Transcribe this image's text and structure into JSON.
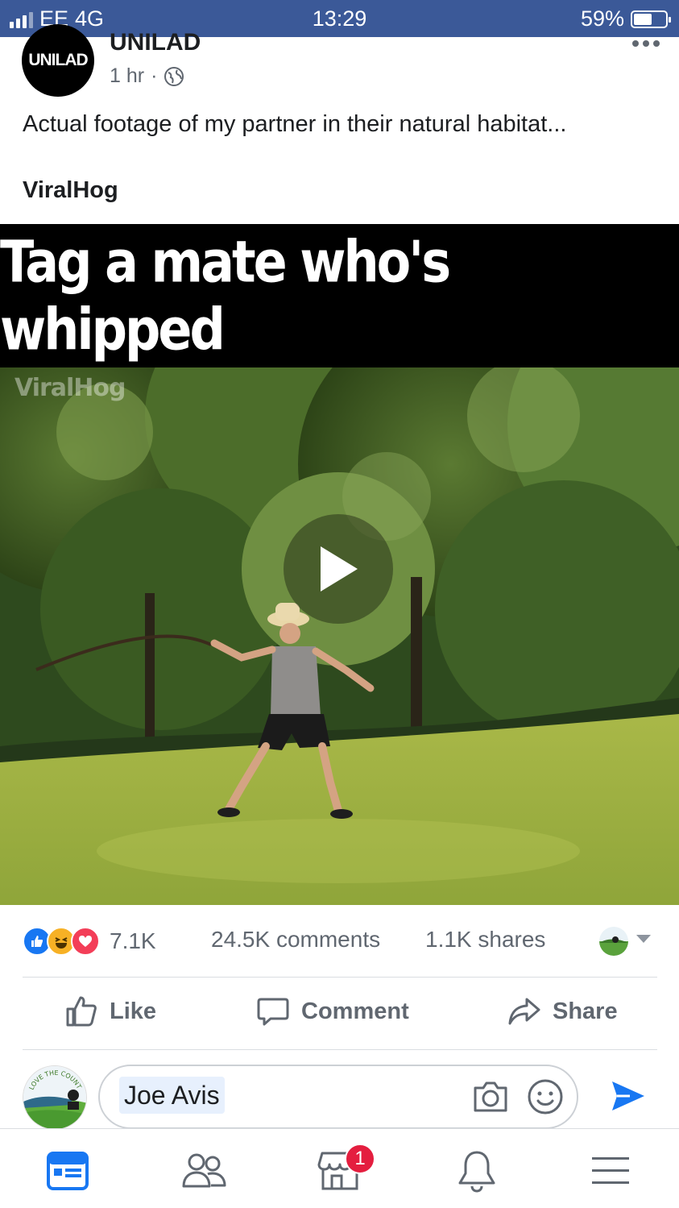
{
  "status_bar": {
    "carrier": "EE",
    "network": "4G",
    "time": "13:29",
    "battery_percent": "59%",
    "battery_level": 0.59
  },
  "post": {
    "page_name": "UNILAD",
    "avatar_text": "UNILAD",
    "time_ago": "1 hr",
    "privacy_icon": "globe-icon",
    "text": "Actual footage of my partner in their natural habitat...",
    "source": "ViralHog",
    "video": {
      "caption": "Tag a mate who's whipped",
      "watermark": "ViralHog"
    }
  },
  "engagement": {
    "reaction_icons": [
      "like-icon",
      "haha-icon",
      "love-icon"
    ],
    "reaction_count": "7.1K",
    "comments": "24.5K comments",
    "shares": "1.1K shares"
  },
  "actions": {
    "like": "Like",
    "comment": "Comment",
    "share": "Share"
  },
  "composer": {
    "mention": "Joe Avis",
    "avatar_text": "LOVE THE COUNTRYSIDE"
  },
  "bottom_nav": {
    "items": [
      "news-feed-icon",
      "friends-icon",
      "marketplace-icon",
      "notifications-icon",
      "menu-icon"
    ],
    "marketplace_badge": "1"
  },
  "colors": {
    "status_bar": "#3b5998",
    "accent": "#1877f2",
    "badge": "#e41e3f",
    "secondary_text": "#606770"
  }
}
